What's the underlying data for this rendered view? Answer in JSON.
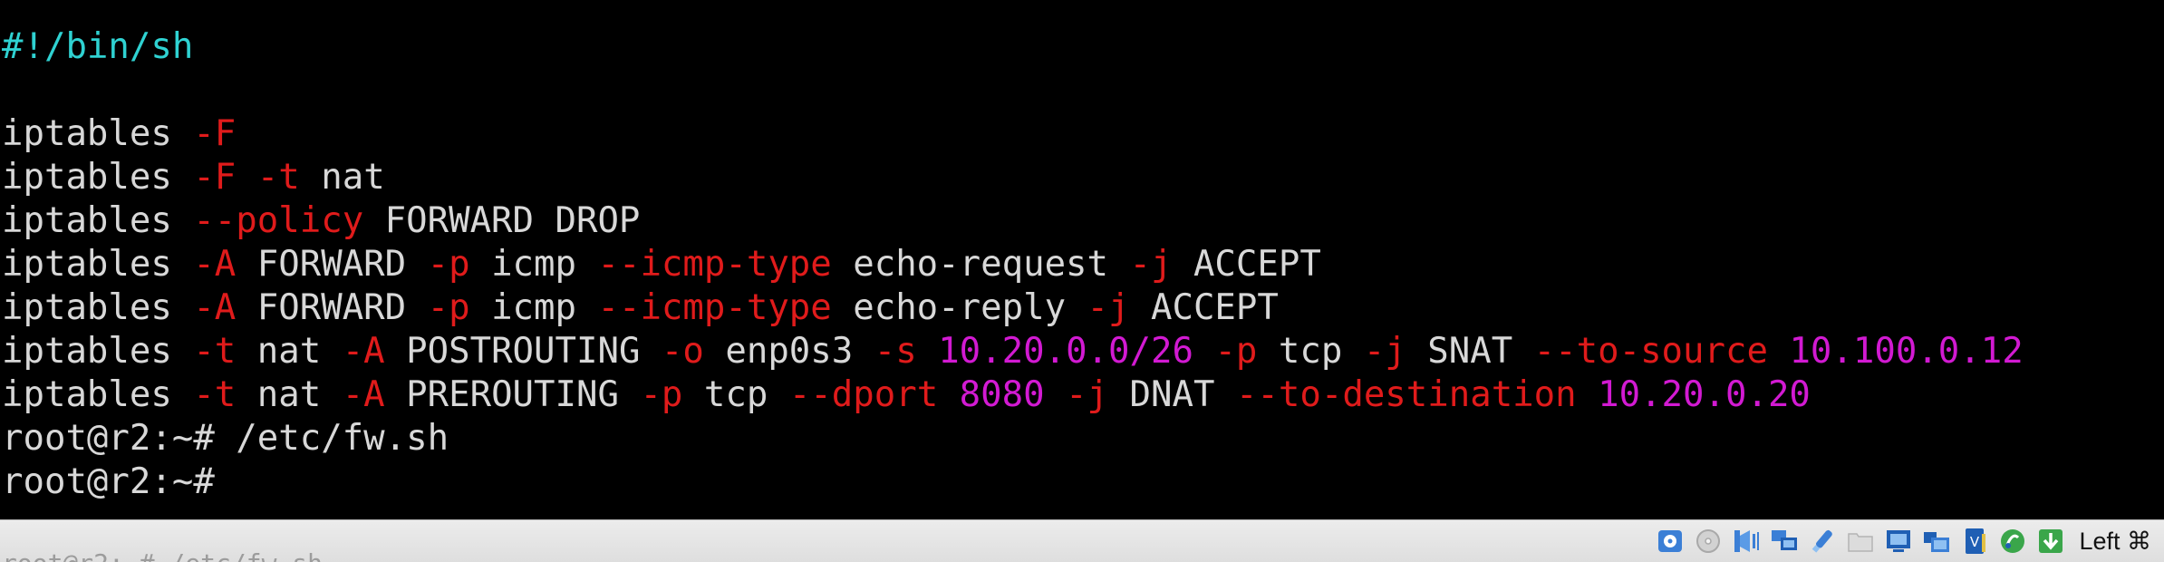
{
  "terminal": {
    "lines": [
      [
        {
          "t": "#!/bin/sh",
          "c": "shebang"
        }
      ],
      [],
      [
        {
          "t": "iptables ",
          "c": "text"
        },
        {
          "t": "-F",
          "c": "flag"
        }
      ],
      [
        {
          "t": "iptables ",
          "c": "text"
        },
        {
          "t": "-F",
          "c": "flag"
        },
        {
          "t": " ",
          "c": "text"
        },
        {
          "t": "-t",
          "c": "flag"
        },
        {
          "t": " nat",
          "c": "text"
        }
      ],
      [
        {
          "t": "iptables ",
          "c": "text"
        },
        {
          "t": "--policy",
          "c": "flag"
        },
        {
          "t": " FORWARD DROP",
          "c": "text"
        }
      ],
      [
        {
          "t": "iptables ",
          "c": "text"
        },
        {
          "t": "-A",
          "c": "flag"
        },
        {
          "t": " FORWARD ",
          "c": "text"
        },
        {
          "t": "-p",
          "c": "flag"
        },
        {
          "t": " icmp ",
          "c": "text"
        },
        {
          "t": "--icmp-type",
          "c": "flag"
        },
        {
          "t": " echo-request ",
          "c": "text"
        },
        {
          "t": "-j",
          "c": "flag"
        },
        {
          "t": " ACCEPT",
          "c": "text"
        }
      ],
      [
        {
          "t": "iptables ",
          "c": "text"
        },
        {
          "t": "-A",
          "c": "flag"
        },
        {
          "t": " FORWARD ",
          "c": "text"
        },
        {
          "t": "-p",
          "c": "flag"
        },
        {
          "t": " icmp ",
          "c": "text"
        },
        {
          "t": "--icmp-type",
          "c": "flag"
        },
        {
          "t": " echo-reply ",
          "c": "text"
        },
        {
          "t": "-j",
          "c": "flag"
        },
        {
          "t": " ACCEPT",
          "c": "text"
        }
      ],
      [
        {
          "t": "iptables ",
          "c": "text"
        },
        {
          "t": "-t",
          "c": "flag"
        },
        {
          "t": " nat ",
          "c": "text"
        },
        {
          "t": "-A",
          "c": "flag"
        },
        {
          "t": " POSTROUTING ",
          "c": "text"
        },
        {
          "t": "-o",
          "c": "flag"
        },
        {
          "t": " enp0s3 ",
          "c": "text"
        },
        {
          "t": "-s",
          "c": "flag"
        },
        {
          "t": " ",
          "c": "text"
        },
        {
          "t": "10.20.0.0/26",
          "c": "number"
        },
        {
          "t": " ",
          "c": "text"
        },
        {
          "t": "-p",
          "c": "flag"
        },
        {
          "t": " tcp ",
          "c": "text"
        },
        {
          "t": "-j",
          "c": "flag"
        },
        {
          "t": " SNAT ",
          "c": "text"
        },
        {
          "t": "--to-source",
          "c": "flag"
        },
        {
          "t": " ",
          "c": "text"
        },
        {
          "t": "10.100.0.12",
          "c": "number"
        }
      ],
      [
        {
          "t": "iptables ",
          "c": "text"
        },
        {
          "t": "-t",
          "c": "flag"
        },
        {
          "t": " nat ",
          "c": "text"
        },
        {
          "t": "-A",
          "c": "flag"
        },
        {
          "t": " PREROUTING ",
          "c": "text"
        },
        {
          "t": "-p",
          "c": "flag"
        },
        {
          "t": " tcp ",
          "c": "text"
        },
        {
          "t": "--dport",
          "c": "flag"
        },
        {
          "t": " ",
          "c": "text"
        },
        {
          "t": "8080",
          "c": "number"
        },
        {
          "t": " ",
          "c": "text"
        },
        {
          "t": "-j",
          "c": "flag"
        },
        {
          "t": " DNAT ",
          "c": "text"
        },
        {
          "t": "--to-destination",
          "c": "flag"
        },
        {
          "t": " ",
          "c": "text"
        },
        {
          "t": "10.20.0.20",
          "c": "number"
        }
      ],
      [
        {
          "t": "root@r2:~# /etc/fw.sh",
          "c": "text"
        }
      ],
      [
        {
          "t": "root@r2:~#",
          "c": "text"
        }
      ]
    ],
    "ghost_text": "root@r2:~# /etc/fw.sh"
  },
  "colors": {
    "background": "#000000",
    "text": "#d8d8d8",
    "shebang": "#2fd2d2",
    "flag": "#e01b1b",
    "number": "#d21ad2",
    "statusbar": "#e6e6e6"
  },
  "statusbar": {
    "icons": [
      {
        "name": "hard-disk-icon",
        "active": true
      },
      {
        "name": "optical-drive-icon",
        "active": false
      },
      {
        "name": "audio-icon",
        "active": true
      },
      {
        "name": "network-icon",
        "active": true
      },
      {
        "name": "usb-icon",
        "active": true
      },
      {
        "name": "shared-folders-icon",
        "active": false
      },
      {
        "name": "display-icon",
        "active": true
      },
      {
        "name": "video-capture-icon",
        "active": true
      },
      {
        "name": "cpu-icon",
        "active": true
      },
      {
        "name": "mouse-integration-icon",
        "active": true
      },
      {
        "name": "keyboard-capture-icon",
        "active": true
      }
    ],
    "host_key": "Left ⌘"
  }
}
